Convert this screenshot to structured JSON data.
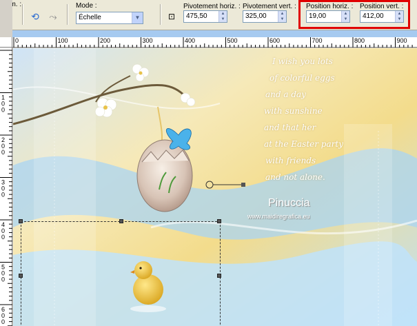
{
  "toolbar": {
    "param_label": "aram. :",
    "mode_label": "Mode :",
    "mode_value": "Échelle",
    "pivot_h_label": "Pivotement horiz. :",
    "pivot_h_value": "475,50",
    "pivot_v_label": "Pivotement vert. :",
    "pivot_v_value": "325,00",
    "pos_h_label": "Position horiz. :",
    "pos_h_value": "19,00",
    "pos_v_label": "Position vert. :",
    "pos_v_value": "412,00",
    "highlight_color": "#e00000"
  },
  "ruler": {
    "h_labels": [
      "0",
      "100",
      "200",
      "300",
      "400",
      "500",
      "600",
      "700",
      "800",
      "900"
    ],
    "v_labels": [
      "1\n0\n0",
      "2\n0\n0",
      "3\n0\n0",
      "4\n0\n0",
      "5\n0\n0",
      "6\n0\n0"
    ]
  },
  "canvas": {
    "poem": [
      "I wish you lots",
      "of colorful eggs",
      "and a day",
      "with sunshine",
      "and that her",
      "at the Easter party",
      "with friends",
      "and not alone."
    ],
    "signature_name": "Pinuccia",
    "signature_url": "www.maidiregrafica.eu"
  },
  "colors": {
    "bg_blue": "#a9d4f3",
    "bg_yellow": "#f3dc8c",
    "accent_selection": "#333333"
  },
  "icons": [
    "pointer-tool-icon",
    "undo-icon",
    "redo-icon",
    "dropdown-icon",
    "pivot-icon",
    "spin-arrow-icon"
  ]
}
